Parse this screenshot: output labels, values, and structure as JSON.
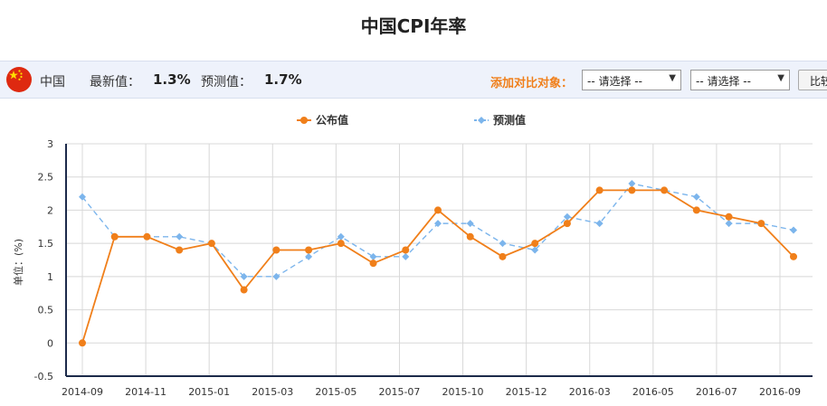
{
  "page_title": "中国CPI年率",
  "info_bar": {
    "country": "中国",
    "latest_label": "最新值：",
    "latest_value": "1.3%",
    "forecast_label": "预测值：",
    "forecast_value": "1.7%",
    "compare_label": "添加对比对象：",
    "select1": "-- 请选择 --",
    "select2": "-- 请选择 --",
    "compare_button": "比较"
  },
  "icons": {
    "flag": "china-flag-icon",
    "select_arrow": "chevron-down-icon"
  },
  "colors": {
    "published": "#f07f1a",
    "forecast": "#7cb5ec",
    "info_bar_bg": "#eef2fb",
    "compare_label": "#f07f1a"
  },
  "chart_data": {
    "type": "line",
    "title": "",
    "xlabel": "",
    "ylabel": "单位：(%)",
    "ylim": [
      -0.5,
      3
    ],
    "yticks": [
      "3",
      "2.5",
      "2",
      "1.5",
      "1",
      "0.5",
      "0",
      "-0.5"
    ],
    "xticks": [
      "2014-09",
      "2014-11",
      "2015-01",
      "2015-03",
      "2015-05",
      "2015-07",
      "2015-10",
      "2015-12",
      "2016-03",
      "2016-05",
      "2016-07",
      "2016-09"
    ],
    "legend_position": "top-center",
    "grid": true,
    "series": [
      {
        "name": "公布值",
        "style": "solid",
        "color": "#f07f1a",
        "values": [
          0,
          1.6,
          1.6,
          1.4,
          1.5,
          0.8,
          1.4,
          1.4,
          1.5,
          1.2,
          1.4,
          2.0,
          1.6,
          1.3,
          1.5,
          1.8,
          2.3,
          2.3,
          2.3,
          2.0,
          1.9,
          1.8,
          1.3
        ]
      },
      {
        "name": "预测值",
        "style": "dashed",
        "color": "#7cb5ec",
        "values": [
          2.2,
          1.6,
          1.6,
          1.6,
          1.5,
          1.0,
          1.0,
          1.3,
          1.6,
          1.3,
          1.3,
          1.8,
          1.8,
          1.5,
          1.4,
          1.9,
          1.8,
          2.4,
          2.3,
          2.2,
          1.8,
          1.8,
          1.7
        ]
      }
    ]
  }
}
